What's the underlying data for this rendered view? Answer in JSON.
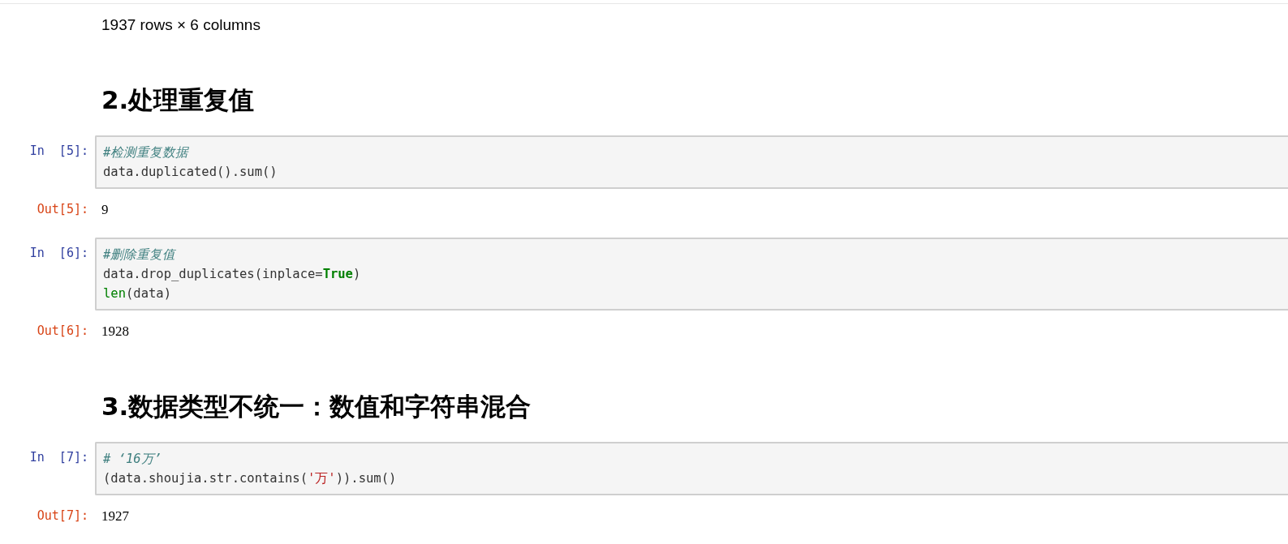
{
  "cells": [
    {
      "kind": "summary",
      "text": "1937 rows × 6 columns"
    },
    {
      "kind": "heading",
      "text": "2.处理重复值"
    },
    {
      "kind": "code",
      "prompt": "In  [5]:",
      "lines": [
        [
          {
            "kind": "comment",
            "text": "#检测重复数据"
          }
        ],
        [
          {
            "kind": "plain",
            "text": "data.duplicated().sum()"
          }
        ]
      ]
    },
    {
      "kind": "output",
      "prompt": "Out[5]:",
      "text": "9"
    },
    {
      "kind": "code",
      "prompt": "In  [6]:",
      "lines": [
        [
          {
            "kind": "comment",
            "text": "#删除重复值"
          }
        ],
        [
          {
            "kind": "plain",
            "text": "data.drop_duplicates(inplace="
          },
          {
            "kind": "keyword",
            "text": "True"
          },
          {
            "kind": "plain",
            "text": ")"
          }
        ],
        [
          {
            "kind": "builtin",
            "text": "len"
          },
          {
            "kind": "plain",
            "text": "(data)"
          }
        ]
      ]
    },
    {
      "kind": "output",
      "prompt": "Out[6]:",
      "text": "1928"
    },
    {
      "kind": "heading",
      "text": "3.数据类型不统一：数值和字符串混合"
    },
    {
      "kind": "code",
      "prompt": "In  [7]:",
      "lines": [
        [
          {
            "kind": "comment",
            "text": "# ‘16万’"
          }
        ],
        [
          {
            "kind": "plain",
            "text": "(data.shoujia.str.contains("
          },
          {
            "kind": "string",
            "text": "'万'"
          },
          {
            "kind": "plain",
            "text": ")).sum()"
          }
        ]
      ]
    },
    {
      "kind": "output",
      "prompt": "Out[7]:",
      "text": "1927"
    }
  ]
}
